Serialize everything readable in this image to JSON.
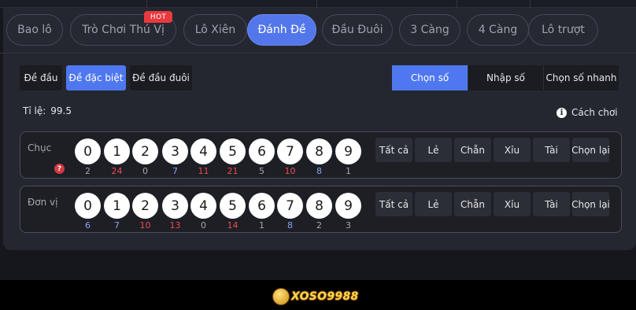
{
  "game_tabs": [
    {
      "label": "Bao lô",
      "active": false
    },
    {
      "label": "Trò Chơi Thú Vị",
      "active": false,
      "badge": "HOT"
    },
    {
      "label": "Lô Xiên",
      "active": false
    },
    {
      "label": "Đánh Đề",
      "active": true
    },
    {
      "label": "Đầu Đuôi",
      "active": false
    },
    {
      "label": "3 Càng",
      "active": false
    },
    {
      "label": "4 Càng",
      "active": false
    },
    {
      "label": "Lô trượt",
      "active": false
    }
  ],
  "bet_types": [
    {
      "label": "Đề đầu",
      "active": false
    },
    {
      "label": "Đề đặc biệt",
      "active": true
    },
    {
      "label": "Đề đầu đuôi",
      "active": false
    }
  ],
  "input_modes": [
    {
      "label": "Chọn số",
      "active": true
    },
    {
      "label": "Nhập số",
      "active": false
    },
    {
      "label": "Chọn số nhanh",
      "active": false
    }
  ],
  "ratio": {
    "label": "Tỉ lệ:",
    "value": "99.5"
  },
  "how_to_play": {
    "label": "Cách chơi",
    "icon": "info-icon"
  },
  "rows": [
    {
      "label": "Chục",
      "numbers": [
        "0",
        "1",
        "2",
        "3",
        "4",
        "5",
        "6",
        "7",
        "8",
        "9"
      ],
      "counts": [
        {
          "value": "2",
          "color": "gray"
        },
        {
          "value": "24",
          "color": "red"
        },
        {
          "value": "0",
          "color": "gray"
        },
        {
          "value": "7",
          "color": "blue"
        },
        {
          "value": "11",
          "color": "red"
        },
        {
          "value": "21",
          "color": "red"
        },
        {
          "value": "5",
          "color": "gray"
        },
        {
          "value": "10",
          "color": "red"
        },
        {
          "value": "8",
          "color": "blue"
        },
        {
          "value": "1",
          "color": "gray"
        }
      ],
      "quick": [
        "Tất cả",
        "Lẻ",
        "Chẵn",
        "Xỉu",
        "Tài",
        "Chọn lại"
      ]
    },
    {
      "label": "Đơn vị",
      "numbers": [
        "0",
        "1",
        "2",
        "3",
        "4",
        "5",
        "6",
        "7",
        "8",
        "9"
      ],
      "counts": [
        {
          "value": "6",
          "color": "blue"
        },
        {
          "value": "7",
          "color": "blue"
        },
        {
          "value": "10",
          "color": "red"
        },
        {
          "value": "13",
          "color": "red"
        },
        {
          "value": "0",
          "color": "gray"
        },
        {
          "value": "14",
          "color": "red"
        },
        {
          "value": "1",
          "color": "gray"
        },
        {
          "value": "8",
          "color": "blue"
        },
        {
          "value": "2",
          "color": "gray"
        },
        {
          "value": "3",
          "color": "gray"
        }
      ],
      "quick": [
        "Tất cả",
        "Lẻ",
        "Chẵn",
        "Xỉu",
        "Tài",
        "Chọn lại"
      ]
    }
  ],
  "logo_text": "XOSO9988",
  "colors": {
    "accent": "#4f78f0",
    "hot": "#e8393f",
    "hot_count": "#ef4a4f",
    "cold_count": "#8aa3f5"
  }
}
